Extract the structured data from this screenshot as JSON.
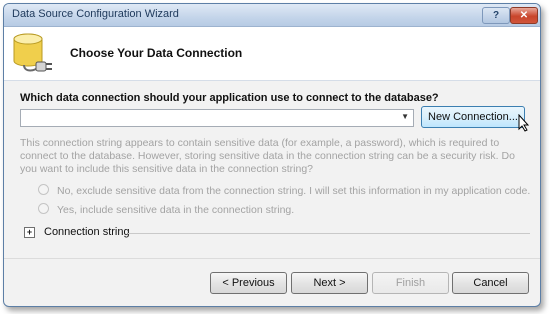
{
  "window": {
    "title": "Data Source Configuration Wizard",
    "help_label": "?",
    "close_label": "✕"
  },
  "header": {
    "title": "Choose Your Data Connection",
    "icon": "database-plug-icon"
  },
  "connection": {
    "question": "Which data connection should your application use to connect to the database?",
    "selected_value": "",
    "new_connection_label": "New Connection..."
  },
  "sensitive": {
    "info": "This connection string appears to contain sensitive data (for example, a password), which is required to connect to the database. However, storing sensitive data in the connection string can be a security risk. Do you want to include this sensitive data in the connection string?",
    "option_exclude": "No, exclude sensitive data from the connection string. I will set this information in my application code.",
    "option_include": "Yes, include sensitive data in the connection string."
  },
  "connection_string": {
    "expander": "+",
    "label": "Connection string"
  },
  "footer": {
    "previous_label": "< Previous",
    "next_label": "Next >",
    "finish_label": "Finish",
    "cancel_label": "Cancel"
  },
  "colors": {
    "title_text": "#1e395b",
    "close_red": "#c9452b",
    "disabled_text": "#a3a3a3"
  }
}
